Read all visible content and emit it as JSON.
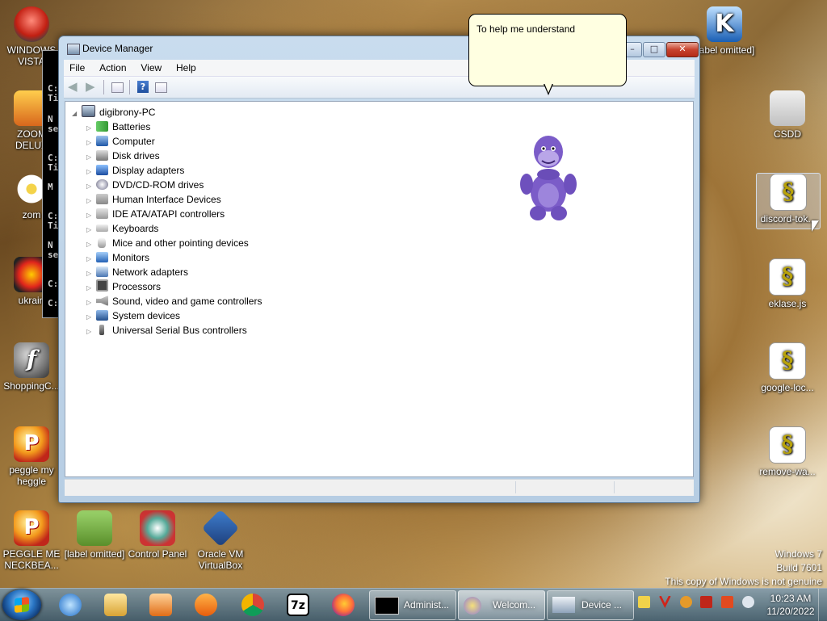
{
  "desktop_icons_left": [
    {
      "label": "WINDOWS VISTA",
      "icon": "vista-icon"
    },
    {
      "label": "ZOOM DELUX",
      "icon": "zuma-icon"
    },
    {
      "label": "zom",
      "icon": "flower-icon"
    },
    {
      "label": "ukrain",
      "icon": "nuke-icon"
    },
    {
      "label": "ShoppingC...",
      "icon": "flash-icon"
    },
    {
      "label": "peggle my heggle",
      "icon": "peggle-icon"
    }
  ],
  "desktop_icons_bottom": [
    {
      "label": "PEGGLE ME NECKBEA...",
      "icon": "peggle-icon"
    },
    {
      "label": "[label omitted]",
      "icon": "bonzi-box-icon"
    },
    {
      "label": "Control Panel",
      "icon": "control-panel-icon"
    },
    {
      "label": "Oracle VM VirtualBox",
      "icon": "virtualbox-icon"
    }
  ],
  "desktop_icons_right": [
    {
      "label": "[label omitted]",
      "icon": "k-icon"
    },
    {
      "label": "CSDD",
      "icon": "folder-icon"
    },
    {
      "label": "discord-tok...",
      "icon": "script-icon"
    },
    {
      "label": "eklase.js",
      "icon": "script-icon"
    },
    {
      "label": "google-loc...",
      "icon": "script-icon"
    },
    {
      "label": "remove-wa...",
      "icon": "script-icon"
    }
  ],
  "window": {
    "title": "Device Manager",
    "menu": [
      "File",
      "Action",
      "View",
      "Help"
    ],
    "tree": {
      "root": "digibrony-PC",
      "children": [
        "Batteries",
        "Computer",
        "Disk drives",
        "Display adapters",
        "DVD/CD-ROM drives",
        "Human Interface Devices",
        "IDE ATA/ATAPI controllers",
        "Keyboards",
        "Mice and other pointing devices",
        "Monitors",
        "Network adapters",
        "Processors",
        "Sound, video and game controllers",
        "System devices",
        "Universal Serial Bus controllers"
      ]
    }
  },
  "balloon": {
    "text": "To help me understand"
  },
  "console_fragment": [
    "C:",
    "Ti",
    "N",
    "se",
    "C:",
    "Ti",
    "M",
    "C:",
    "Ti",
    "N",
    "se",
    "C:",
    "C:"
  ],
  "watermark": {
    "line1": "Windows 7",
    "line2": "Build 7601",
    "line3": "This copy of Windows is not genuine"
  },
  "taskbar": {
    "pinned": [
      "internet-explorer-icon",
      "explorer-folder-icon",
      "media-player-icon",
      "uc-browser-icon",
      "chrome-icon",
      "7zip-icon",
      "firefox-icon"
    ],
    "buttons": [
      {
        "label": "Administ...",
        "icon": "cmd-icon",
        "active": false
      },
      {
        "label": "Welcom...",
        "icon": "bonzi-icon",
        "active": true
      },
      {
        "label": "Device ...",
        "icon": "device-manager-icon",
        "active": false
      }
    ],
    "clock_time": "10:23 AM",
    "clock_date": "11/20/2022"
  },
  "colors": {
    "taskbar": "#4f7488",
    "balloon": "#ffffe1",
    "window_frame": "#c9dcee",
    "bonzi_purple": "#7b5cc8"
  }
}
